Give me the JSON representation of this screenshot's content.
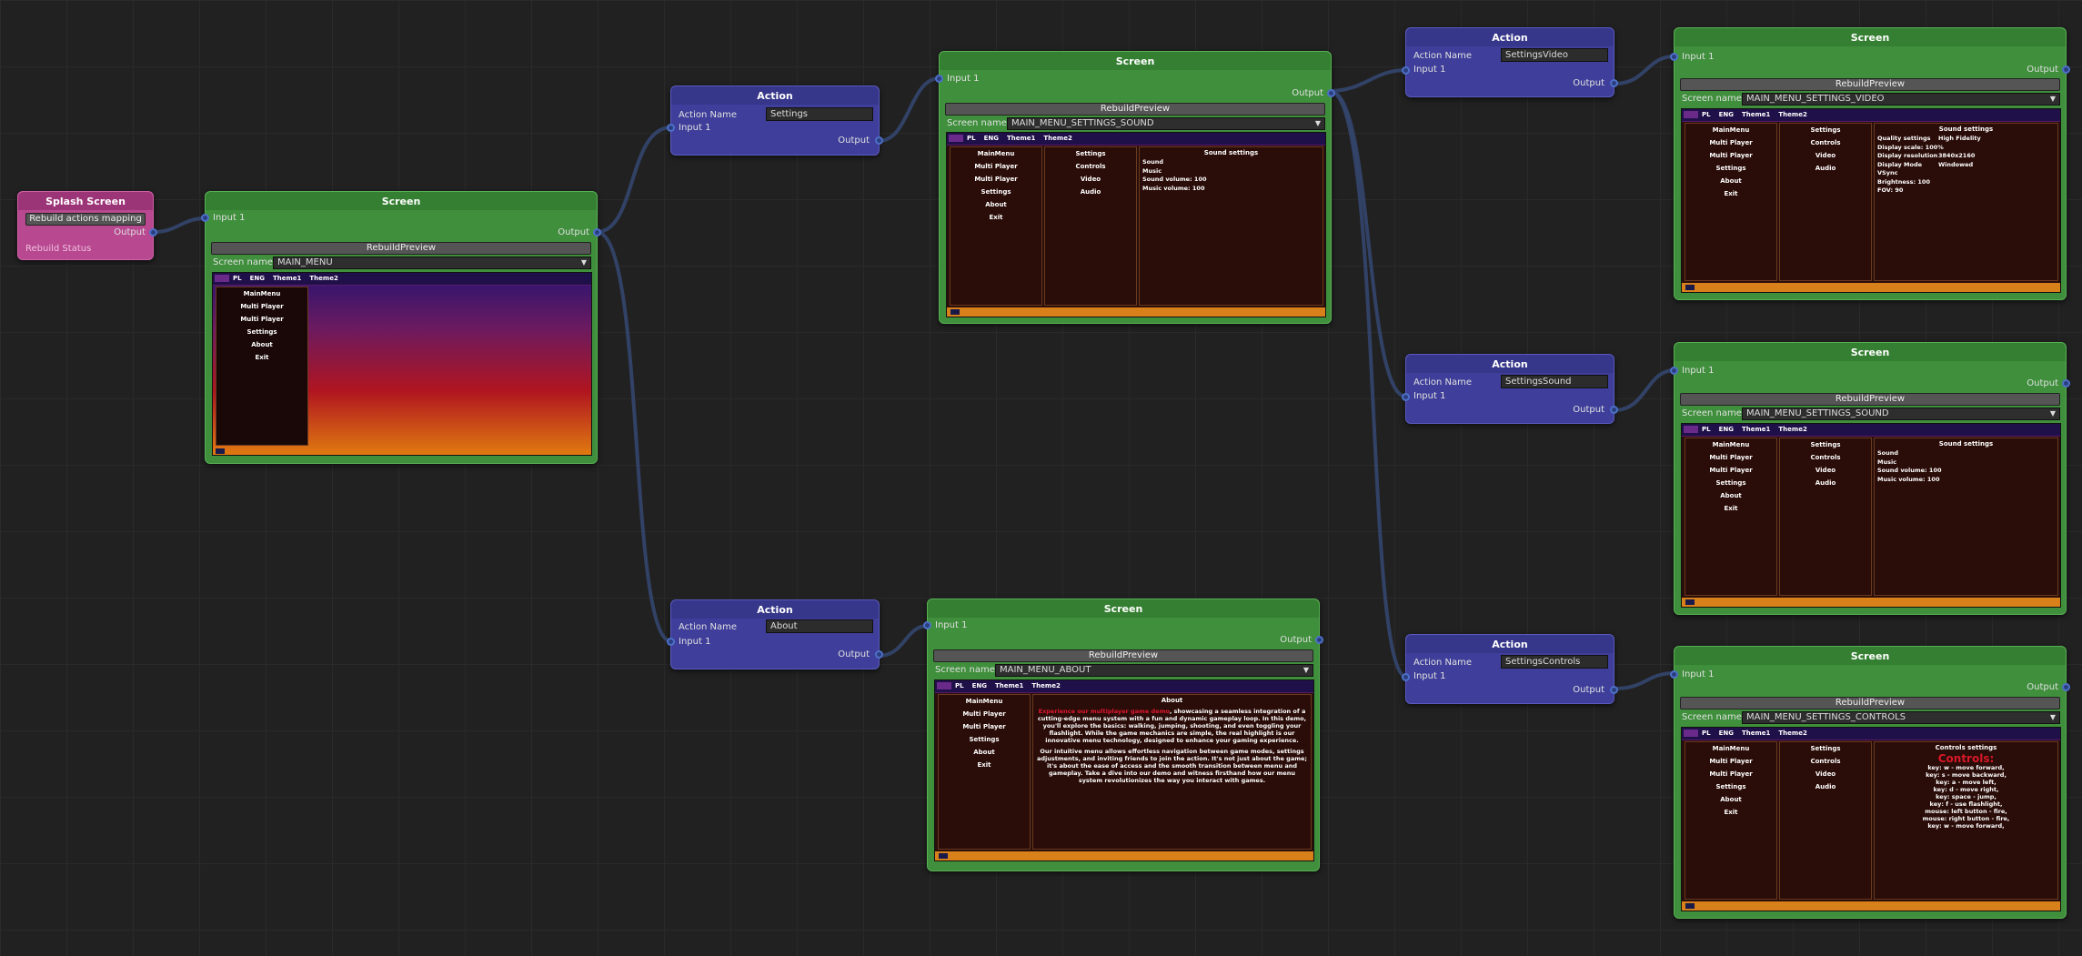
{
  "nodes": {
    "splash": {
      "title": "Splash Screen",
      "button": "Rebuild actions mapping",
      "output": "Output",
      "status": "Rebuild Status"
    },
    "screen_main": {
      "title": "Screen",
      "input": "Input 1",
      "output": "Output",
      "rebuild": "RebuildPreview",
      "screen_name_label": "Screen name:",
      "screen_name": "MAIN_MENU"
    },
    "action_settings": {
      "title": "Action",
      "action_name_label": "Action Name",
      "action_name": "Settings",
      "input": "Input 1",
      "output": "Output"
    },
    "action_about": {
      "title": "Action",
      "action_name_label": "Action Name",
      "action_name": "About",
      "input": "Input 1",
      "output": "Output"
    },
    "screen_sound_top": {
      "title": "Screen",
      "input": "Input 1",
      "output": "Output",
      "rebuild": "RebuildPreview",
      "screen_name_label": "Screen name:",
      "screen_name": "MAIN_MENU_SETTINGS_SOUND"
    },
    "screen_about": {
      "title": "Screen",
      "input": "Input 1",
      "output": "Output",
      "rebuild": "RebuildPreview",
      "screen_name_label": "Screen name:",
      "screen_name": "MAIN_MENU_ABOUT"
    },
    "action_video": {
      "title": "Action",
      "action_name_label": "Action Name",
      "action_name": "SettingsVideo",
      "input": "Input 1",
      "output": "Output"
    },
    "action_sound": {
      "title": "Action",
      "action_name_label": "Action Name",
      "action_name": "SettingsSound",
      "input": "Input 1",
      "output": "Output"
    },
    "action_controls": {
      "title": "Action",
      "action_name_label": "Action Name",
      "action_name": "SettingsControls",
      "input": "Input 1",
      "output": "Output"
    },
    "screen_video": {
      "title": "Screen",
      "input": "Input 1",
      "output": "Output",
      "rebuild": "RebuildPreview",
      "screen_name_label": "Screen name:",
      "screen_name": "MAIN_MENU_SETTINGS_VIDEO"
    },
    "screen_sound": {
      "title": "Screen",
      "input": "Input 1",
      "output": "Output",
      "rebuild": "RebuildPreview",
      "screen_name_label": "Screen name:",
      "screen_name": "MAIN_MENU_SETTINGS_SOUND"
    },
    "screen_controls": {
      "title": "Screen",
      "input": "Input 1",
      "output": "Output",
      "rebuild": "RebuildPreview",
      "screen_name_label": "Screen name:",
      "screen_name": "MAIN_MENU_SETTINGS_CONTROLS"
    }
  },
  "preview": {
    "tabs": [
      "PL",
      "ENG",
      "Theme1",
      "Theme2"
    ],
    "main_menu": [
      "MainMenu",
      "Multi Player",
      "Multi Player",
      "Settings",
      "About",
      "Exit"
    ],
    "settings_menu": [
      "Settings",
      "Controls",
      "Video",
      "Audio"
    ],
    "sound": {
      "title": "Sound settings",
      "rows": [
        "Sound",
        "Music",
        "Sound volume: 100",
        "Music volume: 100"
      ]
    },
    "video": {
      "title": "Sound settings",
      "rows": [
        [
          "Quality settings",
          "High Fidelity"
        ],
        [
          "Display scale: 100%",
          ""
        ],
        [
          "Display resolution",
          "3840x2160"
        ],
        [
          "Display Mode",
          "Windowed"
        ],
        [
          "VSync",
          ""
        ],
        [
          "Brightness: 100",
          ""
        ],
        [
          "FOV: 90",
          ""
        ]
      ]
    },
    "about": {
      "title": "About",
      "p1_highlight": "Experience our multiplayer game demo",
      "p1": ", showcasing a seamless integration of a cutting-edge menu system with a fun and dynamic gameplay loop. In this demo, you'll explore the basics: walking, jumping, shooting, and even toggling your flashlight. While the game mechanics are simple, the real highlight is our innovative menu technology, designed to enhance your gaming experience.",
      "p2": "Our intuitive menu allows effortless navigation between game modes, settings adjustments, and inviting friends to join the action. It's not just about the game; it's about the ease of access and the smooth transition between menu and gameplay. Take a dive into our demo and witness firsthand how our menu system revolutionizes the way you interact with games."
    },
    "controls": {
      "title": "Controls settings",
      "heading": "Controls:",
      "lines": [
        "key: w - move forward,",
        "key: s - move backward,",
        "key: a - move left,",
        "key: d - move right,",
        "key: space - jump,",
        "key: f - use flashlight,",
        "mouse: left button - fire,",
        "mouse: right button - fire,",
        "key: w - move forward,"
      ]
    }
  },
  "colors": {
    "splash": "#b8488f",
    "action": "#3f3f9b",
    "screen": "#3f8f3c",
    "wire": "#3a4a78"
  }
}
